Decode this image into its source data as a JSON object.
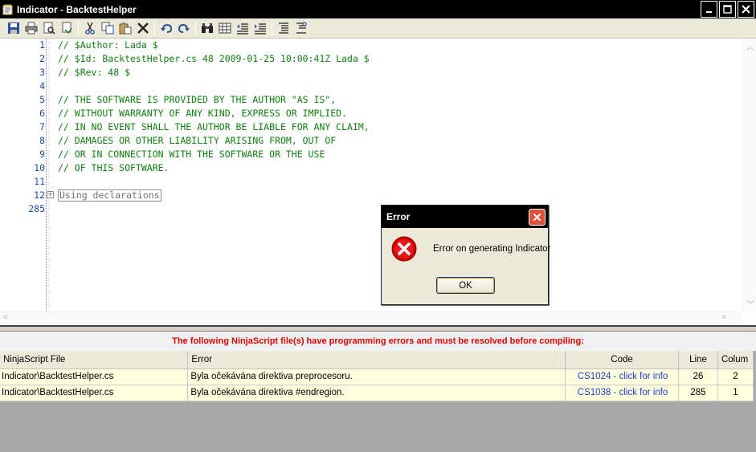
{
  "window": {
    "title": "Indicator - BacktestHelper",
    "controls": [
      "minimize",
      "maximize",
      "close"
    ]
  },
  "toolbar": {
    "buttons": [
      "save",
      "print",
      "print-preview",
      "options",
      "cut",
      "copy",
      "paste",
      "delete",
      "undo",
      "redo",
      "find",
      "replace",
      "outdent",
      "indent",
      "comment",
      "uncomment"
    ]
  },
  "editor": {
    "line_numbers": [
      "1",
      "2",
      "3",
      "4",
      "5",
      "6",
      "7",
      "8",
      "9",
      "10",
      "11",
      "12",
      "285"
    ],
    "lines": [
      "// $Author: Lada $",
      "// $Id: BacktestHelper.cs 48 2009-01-25 10:00:41Z Lada $",
      "// $Rev: 48 $",
      "",
      "// THE SOFTWARE IS PROVIDED BY THE AUTHOR \"AS IS\",",
      "// WITHOUT WARRANTY OF ANY KIND, EXPRESS OR IMPLIED.",
      "// IN NO EVENT SHALL THE AUTHOR BE LIABLE FOR ANY CLAIM,",
      "// DAMAGES OR OTHER LIABILITY ARISING FROM, OUT OF",
      "// OR IN CONNECTION WITH THE SOFTWARE OR THE USE",
      "// OF THIS SOFTWARE.",
      "",
      "Using declarations",
      ""
    ],
    "fold_glyph": "+"
  },
  "error_panel": {
    "heading": "The following NinjaScript file(s) have programming errors and must be resolved before compiling:",
    "columns": [
      "NinjaScript File",
      "Error",
      "Code",
      "Line",
      "Colum"
    ],
    "rows": [
      [
        "Indicator\\BacktestHelper.cs",
        "Byla očekávána direktiva preprocesoru.",
        "CS1024 - click for info",
        "26",
        "2"
      ],
      [
        "Indicator\\BacktestHelper.cs",
        "Byla očekávána direktiva #endregion.",
        "CS1038 - click for info",
        "285",
        "1"
      ]
    ]
  },
  "dialog": {
    "title": "Error",
    "message": "Error on generating Indicator",
    "ok_label": "OK"
  },
  "colors": {
    "comment": "#108010",
    "line_number": "#1a4fa8",
    "error_heading": "#e00000",
    "link": "#1a3fc8",
    "row_bg": "#ffffe0"
  }
}
